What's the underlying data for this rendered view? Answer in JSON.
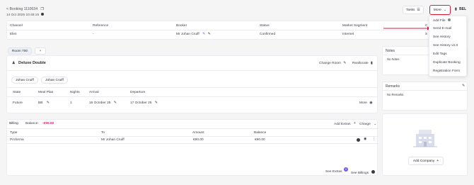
{
  "header": {
    "back_label": "< Booking 1110634",
    "date": "14 Oct 2025 10:48:15",
    "tasks_label": "Tasks",
    "more_label": "More",
    "user_initials": "BEL"
  },
  "more_menu": {
    "items": [
      "Add File",
      "Send E-mail",
      "See History",
      "See History v2.0",
      "Edit Tags",
      "Duplicate Booking",
      "Registration Form"
    ]
  },
  "booking_table": {
    "headers": [
      "Channel",
      "Reference",
      "Booker",
      "Status",
      "Market Segment",
      "C"
    ],
    "row": {
      "channel": "Elen",
      "reference": "-",
      "booker": "Mr Johan Cruiff",
      "status": "Confirmed",
      "market_segment": "Internet",
      "last": "S"
    }
  },
  "rooms": {
    "tab_label": "Room 700",
    "add_tab": "+",
    "room_type": "Deluxe Double",
    "change_room": "Change Room",
    "reallocate": "Reallocate",
    "guests": [
      "Johan Cruiff",
      "Johan Cruiff"
    ],
    "headers": [
      "State",
      "Meal Plan",
      "Nights",
      "Arrival",
      "Departure"
    ],
    "row": {
      "state": "Future",
      "meal_plan": "BB",
      "nights": "1",
      "arrival": "16 October 25",
      "departure": "17 October 25",
      "more": "More"
    }
  },
  "notes": {
    "title": "Notes",
    "empty": "No Notes"
  },
  "remarks": {
    "title": "Remarks",
    "empty": "No Remarks"
  },
  "company": {
    "add_label": "Add Company"
  },
  "billing": {
    "tab_label": "Billing",
    "balance_label": "Balance:",
    "balance_value": "-€90.00",
    "add_extras": "Add Extras",
    "charge": "Charge",
    "headers": [
      "Type",
      "To",
      "Amount",
      "Balance"
    ],
    "row": {
      "type": "Proforma",
      "to": "Mr Johan Cruiff",
      "amount": "€90.00",
      "balance": "€90.00"
    },
    "see_extras": "See Extras",
    "extras_count": "0",
    "see_billings": "See Billings"
  },
  "colors": {
    "accent": "#d6213b",
    "balance_red": "#e0245e",
    "purple": "#6c5ce7"
  }
}
